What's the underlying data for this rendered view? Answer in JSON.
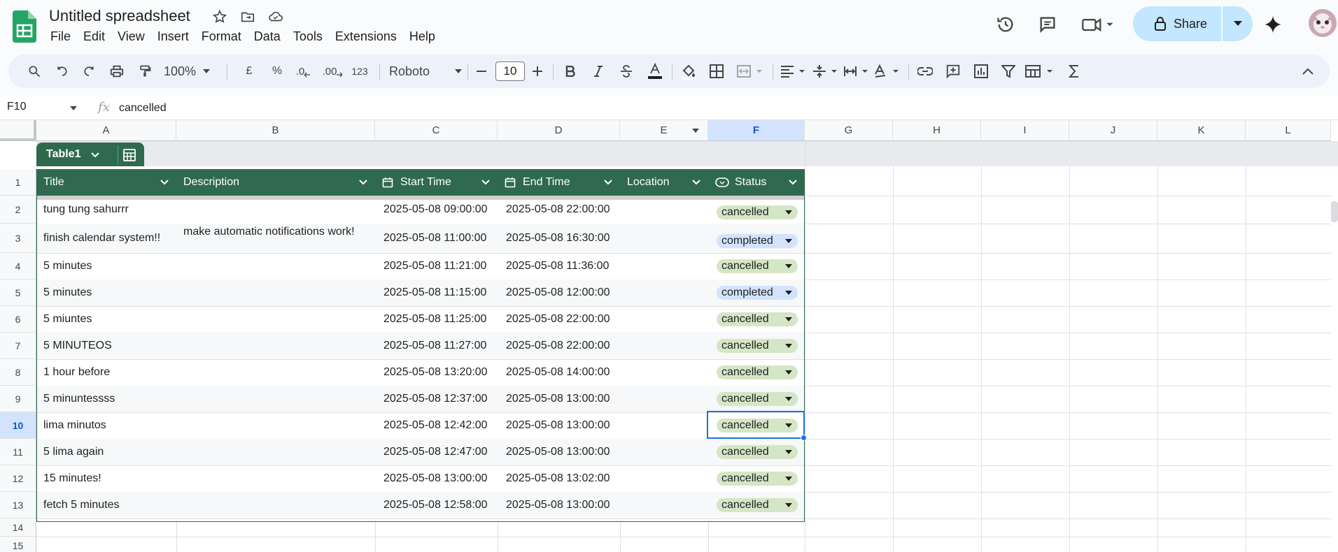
{
  "app": {
    "doc_title": "Untitled spreadsheet",
    "menus": [
      "File",
      "Edit",
      "View",
      "Insert",
      "Format",
      "Data",
      "Tools",
      "Extensions",
      "Help"
    ],
    "share_label": "Share"
  },
  "toolbar": {
    "zoom": "100%",
    "currency": "£",
    "percent": "%",
    "dec_less": ".0",
    "dec_more": ".00",
    "num_format": "123",
    "font": "Roboto",
    "font_size": "10"
  },
  "formula_bar": {
    "cell_ref": "F10",
    "fx": "fx",
    "value": "cancelled"
  },
  "columns": [
    "A",
    "B",
    "C",
    "D",
    "E",
    "F",
    "G",
    "H",
    "I",
    "J",
    "K",
    "L"
  ],
  "selected_column": "F",
  "row_numbers": [
    "1",
    "2",
    "3",
    "4",
    "5",
    "6",
    "7",
    "8",
    "9",
    "10",
    "11",
    "12",
    "13",
    "14",
    "15"
  ],
  "selected_row": "10",
  "table": {
    "name": "Table1",
    "headers": [
      "Title",
      "Description",
      "Start Time",
      "End Time",
      "Location",
      "Status"
    ],
    "rows": [
      {
        "title": "tung tung sahurrr",
        "description": "",
        "start": "2025-05-08 09:00:00",
        "end": "2025-05-08 22:00:00",
        "location": "",
        "status": "cancelled"
      },
      {
        "title": "finish calendar system!!",
        "description": "make automatic notifications work!",
        "start": "2025-05-08 11:00:00",
        "end": "2025-05-08 16:30:00",
        "location": "",
        "status": "completed"
      },
      {
        "title": "5 minutes",
        "description": "",
        "start": "2025-05-08 11:21:00",
        "end": "2025-05-08 11:36:00",
        "location": "",
        "status": "cancelled"
      },
      {
        "title": "5 minutes",
        "description": "",
        "start": "2025-05-08 11:15:00",
        "end": "2025-05-08 12:00:00",
        "location": "",
        "status": "completed"
      },
      {
        "title": "5 miuntes",
        "description": "",
        "start": "2025-05-08 11:25:00",
        "end": "2025-05-08 22:00:00",
        "location": "",
        "status": "cancelled"
      },
      {
        "title": "5 MINUTEOS",
        "description": "",
        "start": "2025-05-08 11:27:00",
        "end": "2025-05-08 22:00:00",
        "location": "",
        "status": "cancelled"
      },
      {
        "title": "1 hour before",
        "description": "",
        "start": "2025-05-08 13:20:00",
        "end": "2025-05-08 14:00:00",
        "location": "",
        "status": "cancelled"
      },
      {
        "title": "5 minuntessss",
        "description": "",
        "start": "2025-05-08 12:37:00",
        "end": "2025-05-08 13:00:00",
        "location": "",
        "status": "cancelled"
      },
      {
        "title": "lima minutos",
        "description": "",
        "start": "2025-05-08 12:42:00",
        "end": "2025-05-08 13:00:00",
        "location": "",
        "status": "cancelled"
      },
      {
        "title": "5 lima again",
        "description": "",
        "start": "2025-05-08 12:47:00",
        "end": "2025-05-08 13:00:00",
        "location": "",
        "status": "cancelled"
      },
      {
        "title": "15 minutes!",
        "description": "",
        "start": "2025-05-08 13:00:00",
        "end": "2025-05-08 13:02:00",
        "location": "",
        "status": "cancelled"
      },
      {
        "title": "fetch 5 minutes",
        "description": "",
        "start": "2025-05-08 12:58:00",
        "end": "2025-05-08 13:00:00",
        "location": "",
        "status": "cancelled"
      }
    ]
  },
  "colors": {
    "table_header": "#2f6a4f",
    "chip_cancelled": "#d4e6c5",
    "chip_completed": "#d3e3fd",
    "selection": "#1a73e8",
    "share_bg": "#c2e7ff"
  }
}
